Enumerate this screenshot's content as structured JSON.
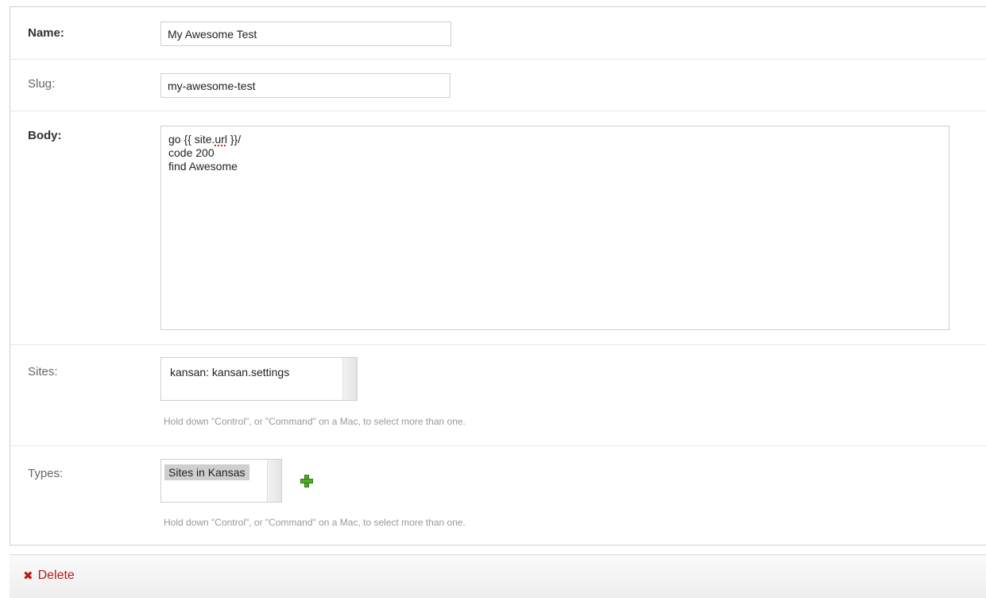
{
  "form": {
    "name": {
      "label": "Name:",
      "value": "My Awesome Test"
    },
    "slug": {
      "label": "Slug:",
      "value": "my-awesome-test"
    },
    "body": {
      "label": "Body:",
      "line1_prefix": "go {{ site.",
      "line1_misspelled": "url",
      "line1_suffix": " }}/",
      "line2": "code 200",
      "line3": "find Awesome"
    },
    "sites": {
      "label": "Sites:",
      "options": [
        "kansan: kansan.settings"
      ],
      "help": "Hold down \"Control\", or \"Command\" on a Mac, to select more than one."
    },
    "types": {
      "label": "Types:",
      "options": [
        "Sites in Kansas"
      ],
      "selected_option": "Sites in Kansas",
      "add_icon": "plus-icon",
      "help": "Hold down \"Control\", or \"Command\" on a Mac, to select more than one."
    }
  },
  "actions": {
    "delete_label": "Delete",
    "delete_icon": "x-icon"
  },
  "colors": {
    "delete": "#c01818",
    "add": "#4eab2c",
    "selected_option_bg": "#cfcfcf"
  }
}
